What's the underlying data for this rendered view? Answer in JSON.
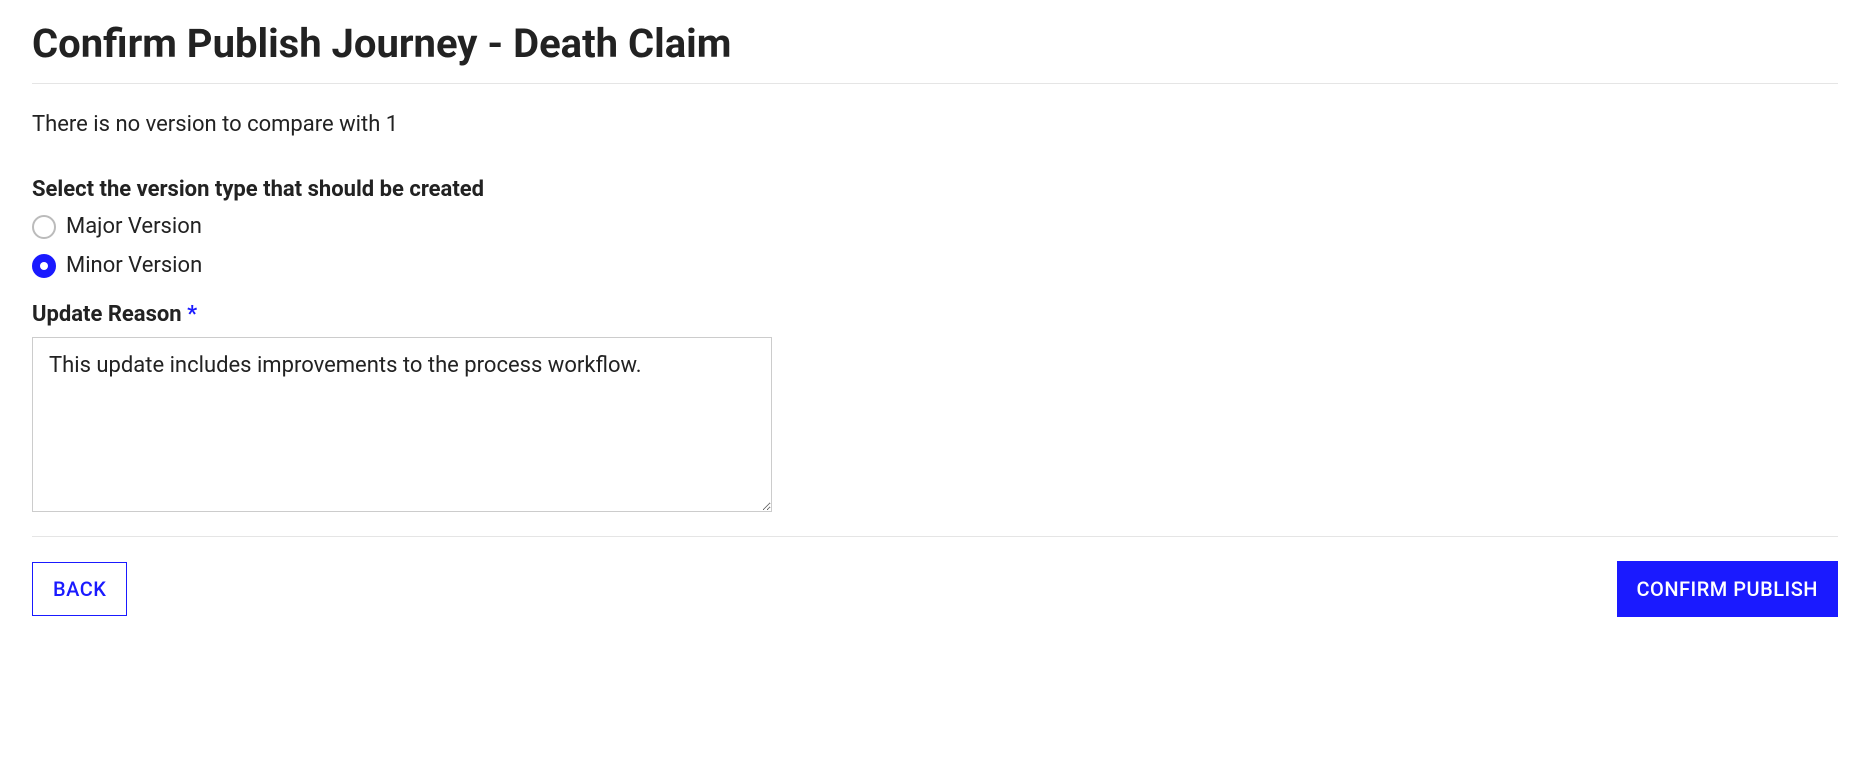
{
  "header": {
    "title": "Confirm Publish Journey - Death Claim"
  },
  "info": {
    "no_compare_text": "There is no version to compare with 1"
  },
  "version_section": {
    "label": "Select the version type that should be created",
    "options": [
      {
        "label": "Major Version",
        "selected": false
      },
      {
        "label": "Minor Version",
        "selected": true
      }
    ]
  },
  "reason_section": {
    "label": "Update Reason",
    "required_marker": "*",
    "value": "This update includes improvements to the process workflow."
  },
  "buttons": {
    "back": "BACK",
    "confirm": "CONFIRM PUBLISH"
  }
}
